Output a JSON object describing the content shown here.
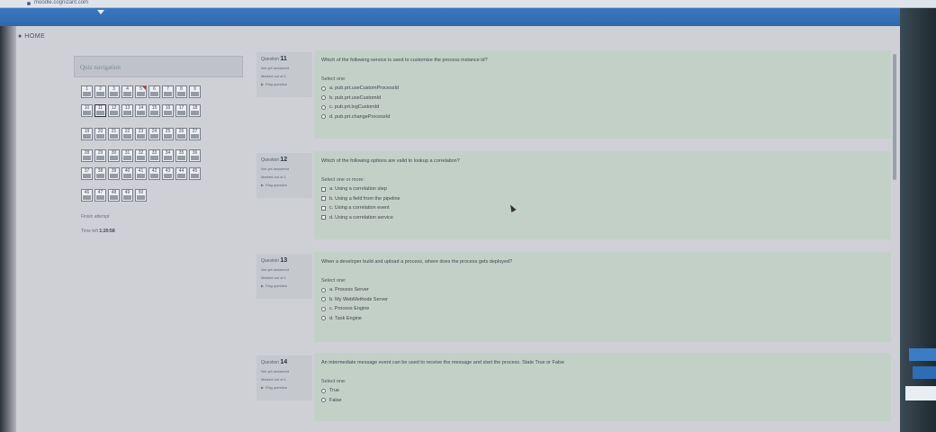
{
  "browser": {
    "url": "moodle.cognizant.com"
  },
  "home": {
    "label": "HOME"
  },
  "quiz_nav": {
    "title": "Quiz navigation",
    "rows": [
      [
        "1",
        "2",
        "3",
        "4",
        "5",
        "6",
        "7",
        "8",
        "9"
      ],
      [
        "10",
        "11",
        "12",
        "13",
        "14",
        "15",
        "16",
        "17",
        "18"
      ],
      [
        "19",
        "20",
        "21",
        "22",
        "23",
        "24",
        "25",
        "26",
        "27"
      ],
      [
        "28",
        "29",
        "30",
        "31",
        "32",
        "33",
        "34",
        "35",
        "36"
      ],
      [
        "37",
        "38",
        "39",
        "40",
        "41",
        "42",
        "43",
        "44",
        "45"
      ],
      [
        "46",
        "47",
        "48",
        "49",
        "50"
      ]
    ],
    "finish": "Finish attempt",
    "time_label": "Time left",
    "time_value": "1:20:58"
  },
  "questions": [
    {
      "label": "Question",
      "number": "11",
      "status": "Not yet answered",
      "marked": "Marked out of 1",
      "flag": "Flag question",
      "text": "Which of the following service is used to customize the process instance id?",
      "select": "Select one:",
      "type": "radio",
      "options": [
        "a. pub.prt.useCustomProcessId",
        "b. pub.prt.useCustomId",
        "c. pub.prt.logCustomId",
        "d. pub.prt.changeProcessId"
      ]
    },
    {
      "label": "Question",
      "number": "12",
      "status": "Not yet answered",
      "marked": "Marked out of 1",
      "flag": "Flag question",
      "text": "Which of the following options are valid to lookup a correlation?",
      "select": "Select one or more:",
      "type": "checkbox",
      "options": [
        "a. Using a correlation step",
        "b. Using a field from the pipeline",
        "c. Using a correlation event",
        "d. Using a correlation service"
      ]
    },
    {
      "label": "Question",
      "number": "13",
      "status": "Not yet answered",
      "marked": "Marked out of 1",
      "flag": "Flag question",
      "text": "When a developer build and upload a process, where does the process gets deployed?",
      "select": "Select one:",
      "type": "radio",
      "options": [
        "a. Process Server",
        "b. My WebMethods Server",
        "c. Process Engine",
        "d. Task Engine"
      ]
    },
    {
      "label": "Question",
      "number": "14",
      "status": "Not yet answered",
      "marked": "Marked out of 1",
      "flag": "Flag question",
      "text": "An intermediate message event can be used to receive the message and start the process. State True or False",
      "select": "Select one:",
      "type": "radio",
      "options": [
        "True",
        "False"
      ]
    }
  ]
}
